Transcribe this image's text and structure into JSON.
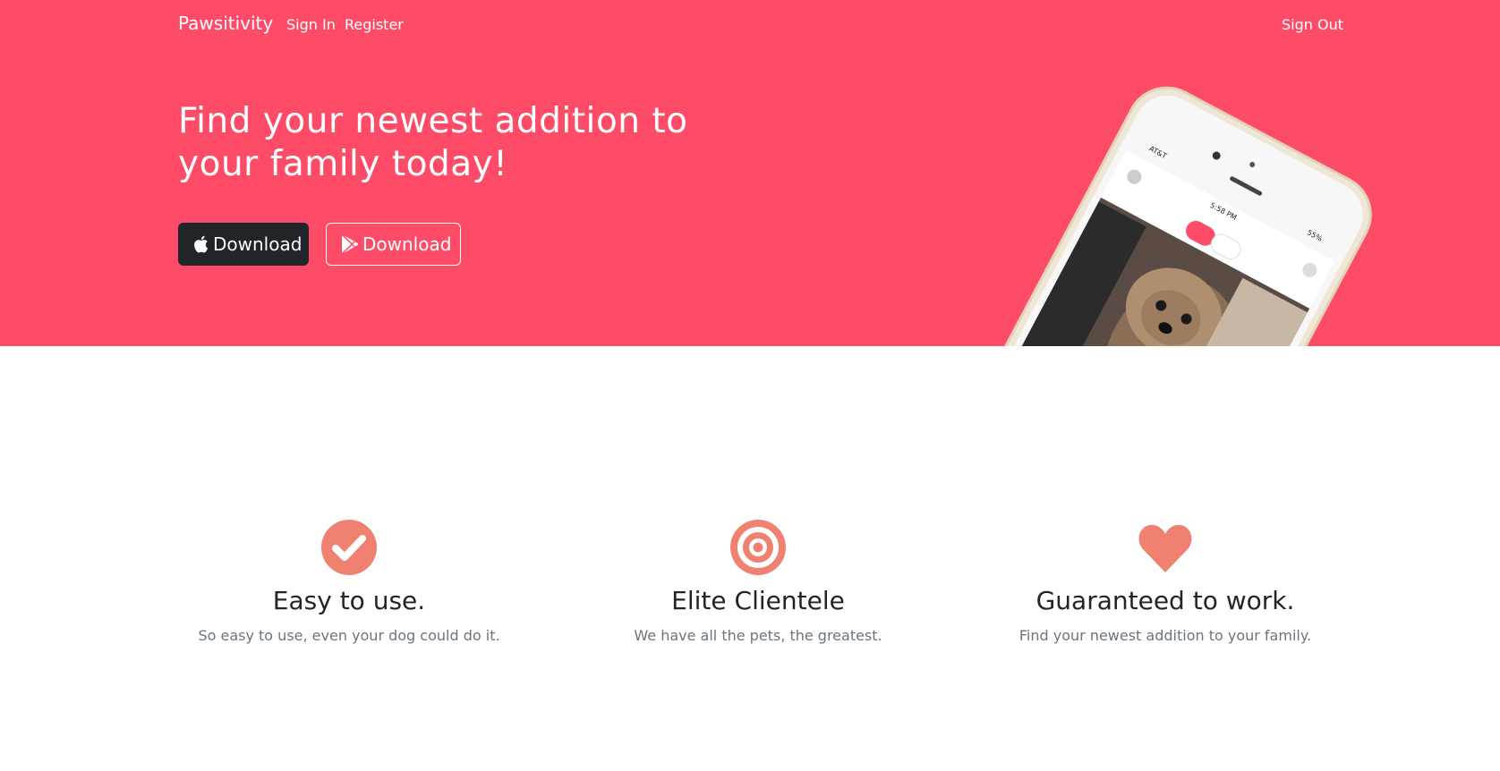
{
  "nav": {
    "brand": "Pawsitivity",
    "links": [
      "Sign In",
      "Register"
    ],
    "sign_out": "Sign Out"
  },
  "hero": {
    "title": "Find your newest addition to your family today!",
    "buttons": [
      {
        "label": "Download",
        "icon": "apple-icon"
      },
      {
        "label": "Download",
        "icon": "google-play-icon"
      }
    ],
    "phone": {
      "carrier": "AT&T",
      "time": "5:58 PM",
      "battery": "55%"
    }
  },
  "features": [
    {
      "icon": "check-circle-icon",
      "title": "Easy to use.",
      "text": "So easy to use, even your dog could do it."
    },
    {
      "icon": "target-icon",
      "title": "Elite Clientele",
      "text": "We have all the pets, the greatest."
    },
    {
      "icon": "heart-icon",
      "title": "Guaranteed to work.",
      "text": "Find your newest addition to your family."
    }
  ],
  "colors": {
    "hero_bg": "#fe4c68",
    "icon_accent": "#f08070",
    "dark_button": "#212529"
  }
}
